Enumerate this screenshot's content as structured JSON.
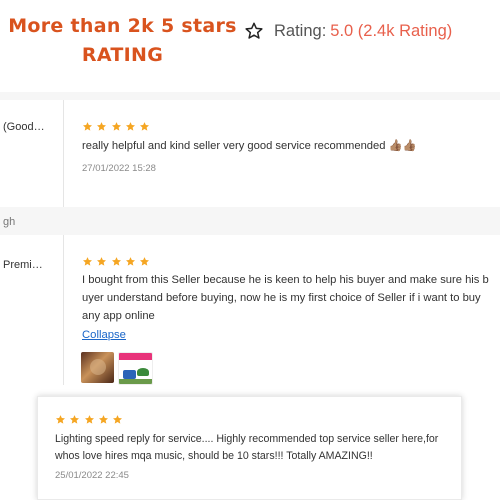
{
  "headline": {
    "line1": "More than 2k 5 stars",
    "line2": "rating"
  },
  "rating": {
    "label": "Rating:",
    "value": "5.0 (2.4k Rating)"
  },
  "colors": {
    "accent": "#d9531e",
    "star": "#f5a623",
    "link": "#1a66c9"
  },
  "left_column": {
    "product_1": "(Good…",
    "strip_text": "gh",
    "product_2": "Premi…"
  },
  "reviews": [
    {
      "stars": 5,
      "text": "really helpful and kind seller very good service recommended 👍🏽👍🏽",
      "date": "27/01/2022 15:28"
    },
    {
      "stars": 5,
      "text_lines": [
        "I bought from this Seller because he is keen to help his buyer and make sure his b",
        "uyer understand before buying, now he is my first choice of Seller if i want to buy",
        "any app online"
      ],
      "collapse_label": "Collapse",
      "thumbnails": [
        "photo-thumbnail-icon",
        "tractor-image-thumbnail-icon"
      ]
    },
    {
      "stars": 5,
      "text_lines": [
        "Lighting speed reply for service.... Highly recommended top service seller here,for",
        "whos love hires mqa music, should be 10 stars!!! Totally AMAZING!!"
      ],
      "date": "25/01/2022 22:45"
    }
  ]
}
